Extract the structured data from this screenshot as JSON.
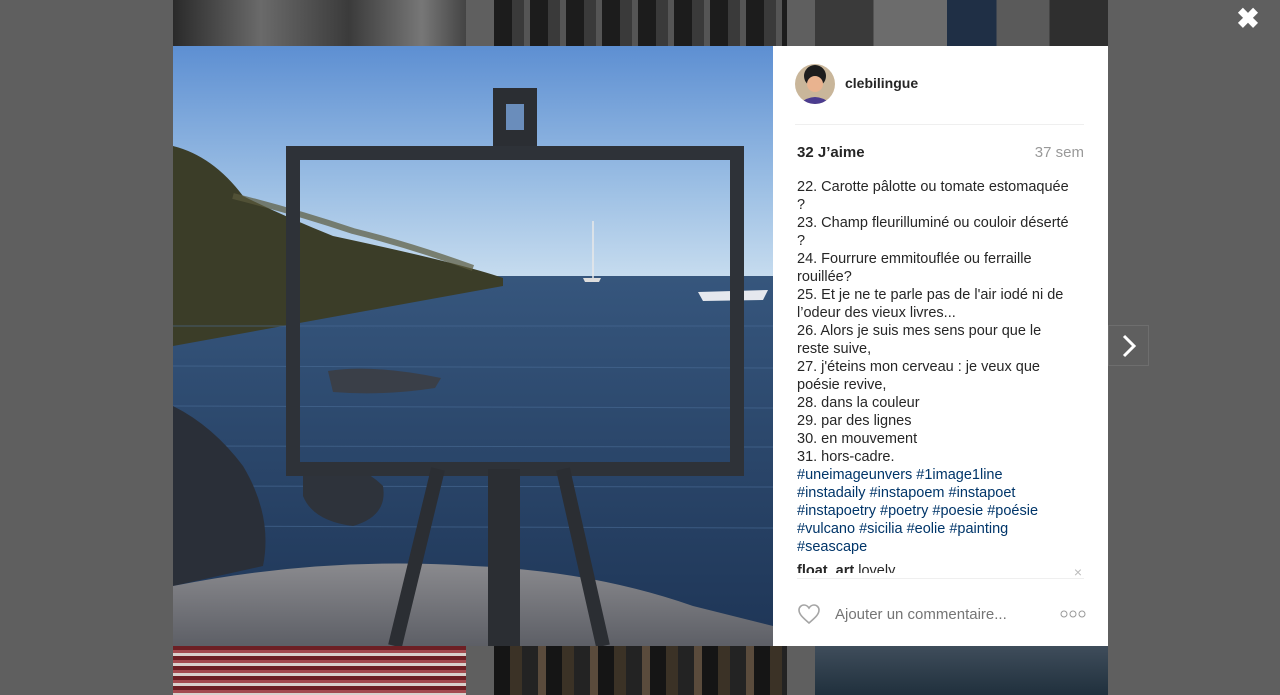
{
  "post": {
    "username": "clebilingue",
    "likes_label": "32 J’aime",
    "time_label": "37 sem",
    "caption_lines": [
      "22. Carotte pâlotte ou tomate estomaquée ?",
      "23. Champ fleurilluminé ou couloir déserté ?",
      "24. Fourrure emmitouflée ou ferraille rouillée?",
      "25. Et je ne te parle pas de l'air iodé ni de l’odeur des vieux livres...",
      "26. Alors je suis mes sens pour que le reste suive,",
      "27. j'éteins mon cerveau : je veux que poésie revive,",
      "28. dans la couleur",
      "29. par des lignes",
      "30. en mouvement",
      "31. hors-cadre."
    ],
    "hashtags": "#uneimageunvers #1image1line #instadaily #instapoem #instapoet #instapoetry #poetry #poesie #poésie #vulcano #sicilia #eolie #painting #seascape",
    "comment": {
      "user": "float_art",
      "text": "lovely"
    },
    "comment_delete": "×",
    "add_comment_placeholder": "Ajouter un commentaire...",
    "photo_alt": "Easel frame at the seaside"
  },
  "controls": {
    "close_glyph": "✖"
  },
  "icons": {
    "close": "close-icon",
    "next": "chevron-right-icon",
    "like": "heart-icon",
    "more": "more-options-icon"
  },
  "colors": {
    "overlay": "#5f5f5f",
    "hashtag": "#003569",
    "text": "#262626",
    "muted": "#999999"
  }
}
